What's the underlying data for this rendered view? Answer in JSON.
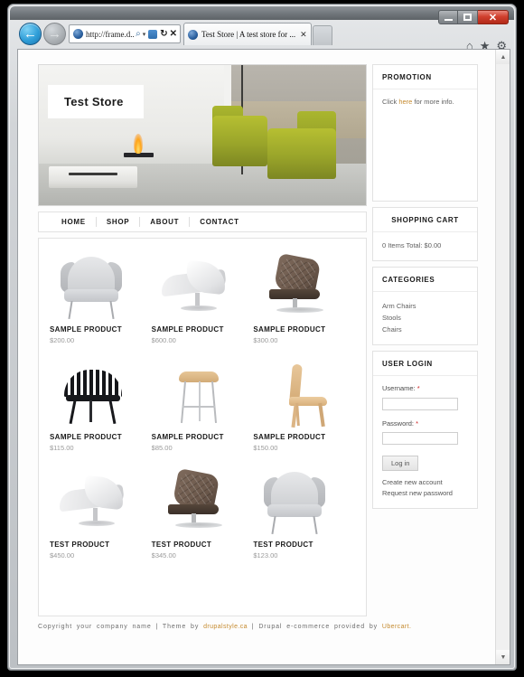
{
  "browser": {
    "tab_title": "Test Store | A test store for ...",
    "url": "http://frame.d...",
    "back_glyph": "←",
    "forward_glyph": "→",
    "search_glyph": "⌕",
    "dropdown_glyph": "▾",
    "refresh_glyph": "↻",
    "stop_glyph": "✕",
    "tab_close_glyph": "✕",
    "home_glyph": "⌂",
    "favorites_glyph": "★",
    "tools_glyph": "⚙",
    "minimize_label": "Minimize",
    "maximize_label": "Maximize",
    "close_label": "✕",
    "scroll_up_glyph": "▲",
    "scroll_down_glyph": "▼"
  },
  "site": {
    "logo": "Test Store",
    "nav": [
      {
        "label": "HOME"
      },
      {
        "label": "SHOP"
      },
      {
        "label": "ABOUT"
      },
      {
        "label": "CONTACT"
      }
    ],
    "products": [
      [
        {
          "title": "SAMPLE PRODUCT",
          "price": "$200.00",
          "art": "wing"
        },
        {
          "title": "SAMPLE PRODUCT",
          "price": "$600.00",
          "art": "swivel"
        },
        {
          "title": "SAMPLE PRODUCT",
          "price": "$300.00",
          "art": "exec"
        }
      ],
      [
        {
          "title": "SAMPLE PRODUCT",
          "price": "$115.00",
          "art": "fan"
        },
        {
          "title": "SAMPLE PRODUCT",
          "price": "$85.00",
          "art": "bar"
        },
        {
          "title": "SAMPLE PRODUCT",
          "price": "$150.00",
          "art": "wood"
        }
      ],
      [
        {
          "title": "TEST PRODUCT",
          "price": "$450.00",
          "art": "swivel"
        },
        {
          "title": "TEST PRODUCT",
          "price": "$345.00",
          "art": "exec"
        },
        {
          "title": "TEST PRODUCT",
          "price": "$123.00",
          "art": "wing"
        }
      ]
    ],
    "sidebar": {
      "promotion": {
        "title": "PROMOTION",
        "text_before": "Click ",
        "link": "here",
        "text_after": " for more info."
      },
      "cart": {
        "title": "SHOPPING CART",
        "summary": "0 Items  Total: $0.00"
      },
      "categories": {
        "title": "CATEGORIES",
        "items": [
          {
            "label": "Arm Chairs"
          },
          {
            "label": "Stools"
          },
          {
            "label": "Chairs"
          }
        ]
      },
      "user_login": {
        "title": "USER LOGIN",
        "username_label": "Username:",
        "username_value": "",
        "password_label": "Password:",
        "password_value": "",
        "required_marker": "*",
        "submit_label": "Log in",
        "create_account_label": "Create new account",
        "request_password_label": "Request new password"
      }
    },
    "footer": {
      "copyright": "Copyright your company name",
      "sep1": "|",
      "theme_by": "Theme by",
      "theme_link": "drupalstyle.ca",
      "sep2": "|",
      "ecommerce_by": "Drupal e-commerce provided by",
      "ecommerce_link": "Ubercart."
    }
  },
  "colors": {
    "accent_link": "#c58a2e",
    "required": "#cc2222",
    "hero_chair": "#9aa52a",
    "close_button": "#d1402e"
  }
}
